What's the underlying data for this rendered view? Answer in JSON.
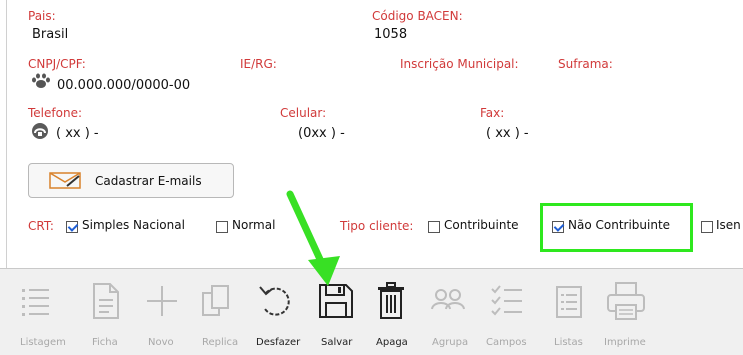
{
  "address": {
    "pais_label": "Pais:",
    "pais_value": "Brasil",
    "bacen_label": "Código BACEN:",
    "bacen_value": "1058"
  },
  "docs": {
    "cnpj_label": "CNPJ/CPF:",
    "cnpj_value": "00.000.000/0000-00",
    "ie_label": "IE/RG:",
    "im_label": "Inscrição Municipal:",
    "suframa_label": "Suframa:"
  },
  "phones": {
    "telefone_label": "Telefone:",
    "telefone_value": "( xx )   -",
    "celular_label": "Celular:",
    "celular_value": "(0xx )   -",
    "fax_label": "Fax:",
    "fax_value": "( xx )   -"
  },
  "emails": {
    "button_label": "Cadastrar E-mails"
  },
  "crt": {
    "label": "CRT:",
    "options": [
      {
        "label": "Simples Nacional",
        "checked": true
      },
      {
        "label": "Normal",
        "checked": false
      }
    ]
  },
  "tipo_cliente": {
    "label": "Tipo cliente:",
    "options": [
      {
        "label": "Contribuinte",
        "checked": false
      },
      {
        "label": "Não Contribuinte",
        "checked": true
      },
      {
        "label": "Isen",
        "checked": false
      }
    ]
  },
  "toolbar": {
    "items": [
      {
        "label": "Listagem",
        "icon": "list-icon",
        "enabled": false
      },
      {
        "label": "Ficha",
        "icon": "document-icon",
        "enabled": false
      },
      {
        "label": "Novo",
        "icon": "plus-icon",
        "enabled": false
      },
      {
        "label": "Replica",
        "icon": "copy-icon",
        "enabled": false
      },
      {
        "label": "Desfazer",
        "icon": "undo-icon",
        "enabled": true
      },
      {
        "label": "Salvar",
        "icon": "save-icon",
        "enabled": true
      },
      {
        "label": "Apaga",
        "icon": "trash-icon",
        "enabled": true
      },
      {
        "label": "Agrupa",
        "icon": "group-icon",
        "enabled": false
      },
      {
        "label": "Campos",
        "icon": "checklist-icon",
        "enabled": false
      },
      {
        "label": "Listas",
        "icon": "list-box-icon",
        "enabled": false
      },
      {
        "label": "Imprime",
        "icon": "printer-icon",
        "enabled": false
      }
    ]
  },
  "colors": {
    "label_red": "#d13a3a",
    "highlight_green": "#2ee81e",
    "arrow_green": "#38e024",
    "checkbox_blue": "#1f5fd6"
  }
}
